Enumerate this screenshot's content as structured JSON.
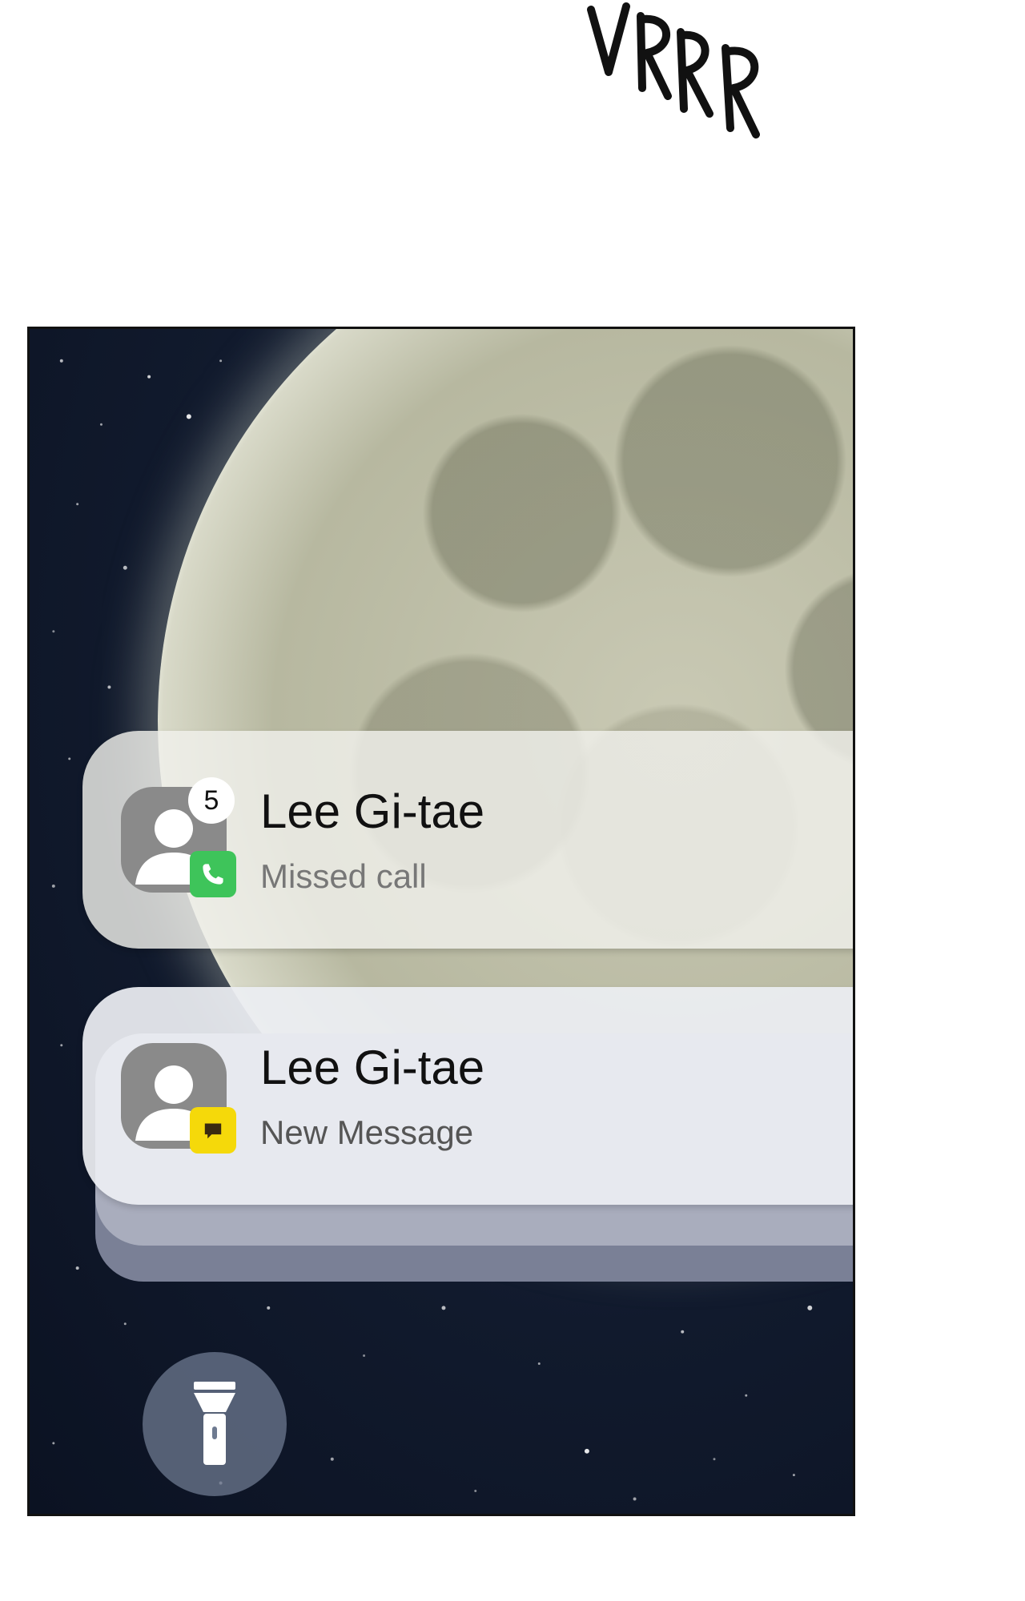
{
  "sound_effect": "VRRR",
  "notifications": [
    {
      "contact_name": "Lee Gi-tae",
      "status": "Missed call",
      "badge_count": "5",
      "app_icon": "phone-icon"
    },
    {
      "contact_name": "Lee Gi-tae",
      "status": "New Message",
      "app_icon": "message-icon"
    }
  ],
  "lockscreen": {
    "background": "moon-night-sky",
    "shortcut_icon": "flashlight-icon"
  },
  "colors": {
    "call_green": "#3ec45a",
    "message_yellow": "#f5d90a",
    "sky": "#111a2d"
  }
}
